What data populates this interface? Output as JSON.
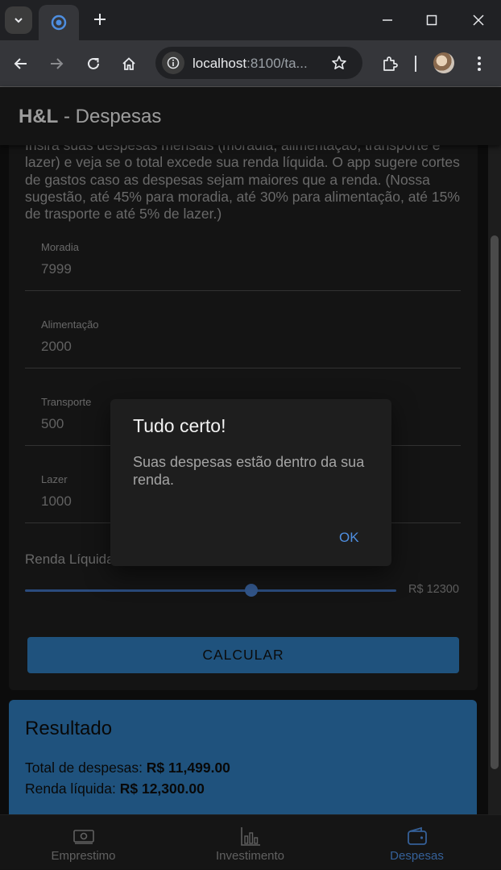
{
  "browser": {
    "url_host": "localhost",
    "url_rest": ":8100/ta..."
  },
  "app": {
    "title_bold": "H&L",
    "title_rest": " - Despesas"
  },
  "form": {
    "intro": "Insira suas despesas mensais (moradia, alimentação, transporte e lazer) e veja se o total excede sua renda líquida. O app sugere cortes de gastos caso as despesas sejam maiores que a renda. (Nossa sugestão, até 45% para moradia, até 30% para alimentação, até 15% de trasporte e até 5% de lazer.)",
    "fields": [
      {
        "label": "Moradia",
        "value": "7999"
      },
      {
        "label": "Alimentação",
        "value": "2000"
      },
      {
        "label": "Transporte",
        "value": "500"
      },
      {
        "label": "Lazer",
        "value": "1000"
      }
    ],
    "range_label": "Renda Líquida",
    "range_value_text": "R$ 12300",
    "range_fraction": 0.61,
    "calculate_label": "CALCULAR"
  },
  "result": {
    "title": "Resultado",
    "total_label": "Total de despesas: ",
    "total_value": "R$ 11,499.00",
    "income_label": "Renda líquida: ",
    "income_value": "R$ 12,300.00"
  },
  "tabs": [
    {
      "label": "Emprestimo",
      "icon": "cash-icon"
    },
    {
      "label": "Investimento",
      "icon": "bar-chart-icon"
    },
    {
      "label": "Despesas",
      "icon": "wallet-icon",
      "active": true
    }
  ],
  "alert": {
    "title": "Tudo certo!",
    "message": "Suas despesas estão dentro da sua renda.",
    "ok_label": "OK"
  },
  "colors": {
    "primary": "#2f7ab8",
    "accent_text": "#4e8ee0",
    "background": "#121212"
  }
}
